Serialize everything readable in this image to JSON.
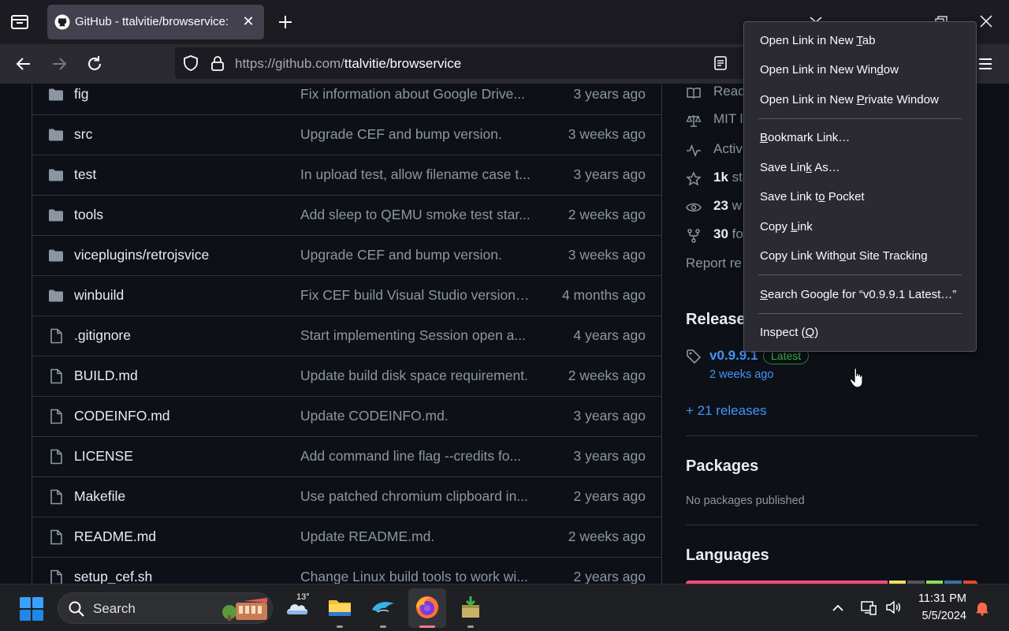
{
  "browser": {
    "tab_title": "GitHub - ttalvitie/browservice: Br",
    "url_host": "https://github.com/",
    "url_path": "ttalvitie/browservice"
  },
  "files": [
    {
      "type": "folder",
      "name": "fig",
      "message": "Fix information about Google Drive...",
      "date": "3 years ago"
    },
    {
      "type": "folder",
      "name": "src",
      "message": "Upgrade CEF and bump version.",
      "date": "3 weeks ago"
    },
    {
      "type": "folder",
      "name": "test",
      "message": "In upload test, allow filename case t...",
      "date": "3 years ago"
    },
    {
      "type": "folder",
      "name": "tools",
      "message": "Add sleep to QEMU smoke test star...",
      "date": "2 weeks ago"
    },
    {
      "type": "folder",
      "name": "viceplugins/retrojsvice",
      "message": "Upgrade CEF and bump version.",
      "date": "3 weeks ago"
    },
    {
      "type": "folder",
      "name": "winbuild",
      "message": "Fix CEF build Visual Studio version t...",
      "date": "4 months ago"
    },
    {
      "type": "file",
      "name": ".gitignore",
      "message": "Start implementing Session open a...",
      "date": "4 years ago"
    },
    {
      "type": "file",
      "name": "BUILD.md",
      "message": "Update build disk space requirement.",
      "date": "2 weeks ago"
    },
    {
      "type": "file",
      "name": "CODEINFO.md",
      "message": "Update CODEINFO.md.",
      "date": "3 years ago"
    },
    {
      "type": "file",
      "name": "LICENSE",
      "message": "Add command line flag --credits fo...",
      "date": "3 years ago"
    },
    {
      "type": "file",
      "name": "Makefile",
      "message": "Use patched chromium clipboard in...",
      "date": "2 years ago"
    },
    {
      "type": "file",
      "name": "README.md",
      "message": "Update README.md.",
      "date": "2 weeks ago"
    },
    {
      "type": "file",
      "name": "setup_cef.sh",
      "message": "Change Linux build tools to work wi...",
      "date": "2 years ago"
    }
  ],
  "sidebar": {
    "readme": "Read",
    "license": "MIT l",
    "activity": "Activ",
    "stars_count": "1k",
    "stars_rest": " sta",
    "watch_count": "23",
    "watch_rest": " w",
    "forks_count": "30",
    "forks_rest": " fo",
    "report": "Report re",
    "releases_heading": "Releases",
    "release_version": "v0.9.9.1",
    "release_badge": "Latest",
    "release_date": "2 weeks ago",
    "more_releases": "+ 21 releases",
    "packages_heading": "Packages",
    "packages_text": "No packages published",
    "languages_heading": "Languages",
    "language_colors": [
      "#f34b7d",
      "#f1e05a",
      "#555555",
      "#89e051",
      "#3572A5",
      "#e34c26"
    ],
    "language_shares": [
      0.71,
      0.06,
      0.06,
      0.06,
      0.06,
      0.05
    ]
  },
  "context_menu": {
    "items": [
      {
        "pre": "Open Link in New ",
        "key": "T",
        "post": "ab"
      },
      {
        "pre": "Open Link in New Win",
        "key": "d",
        "post": "ow"
      },
      {
        "pre": "Open Link in New ",
        "key": "P",
        "post": "rivate Window"
      },
      {
        "pre": "",
        "key": "B",
        "post": "ookmark Link…"
      },
      {
        "pre": "Save Lin",
        "key": "k",
        "post": " As…"
      },
      {
        "pre": "Save Link t",
        "key": "o",
        "post": " Pocket"
      },
      {
        "pre": "Copy ",
        "key": "L",
        "post": "ink"
      },
      {
        "pre": "Copy Link With",
        "key": "o",
        "post": "ut Site Tracking"
      },
      {
        "pre": "",
        "key": "S",
        "post": "earch Google for “v0.9.9.1 Latest…”"
      },
      {
        "pre": "Inspect (",
        "key": "Q",
        "post": ")"
      }
    ]
  },
  "taskbar": {
    "search_label": "Search",
    "weather_temp": "13°",
    "time": "11:31 PM",
    "date": "5/5/2024"
  }
}
